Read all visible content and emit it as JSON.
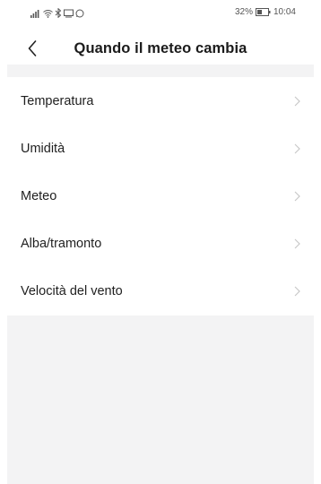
{
  "status_bar": {
    "battery_percent": "32%",
    "time": "10:04",
    "icons": [
      "signal-icon",
      "wifi-icon",
      "bluetooth-icon",
      "cast-icon",
      "whatsapp-icon",
      "battery-icon"
    ]
  },
  "header": {
    "title": "Quando il meteo cambia",
    "back_icon": "chevron-left-icon"
  },
  "menu": {
    "items": [
      {
        "label": "Temperatura"
      },
      {
        "label": "Umidità"
      },
      {
        "label": "Meteo"
      },
      {
        "label": "Alba/tramonto"
      },
      {
        "label": "Velocità del vento"
      }
    ]
  },
  "colors": {
    "background": "#ffffff",
    "section_gray": "#f3f3f4",
    "chevron": "#c8c8c8",
    "text": "#1f1f1f"
  }
}
